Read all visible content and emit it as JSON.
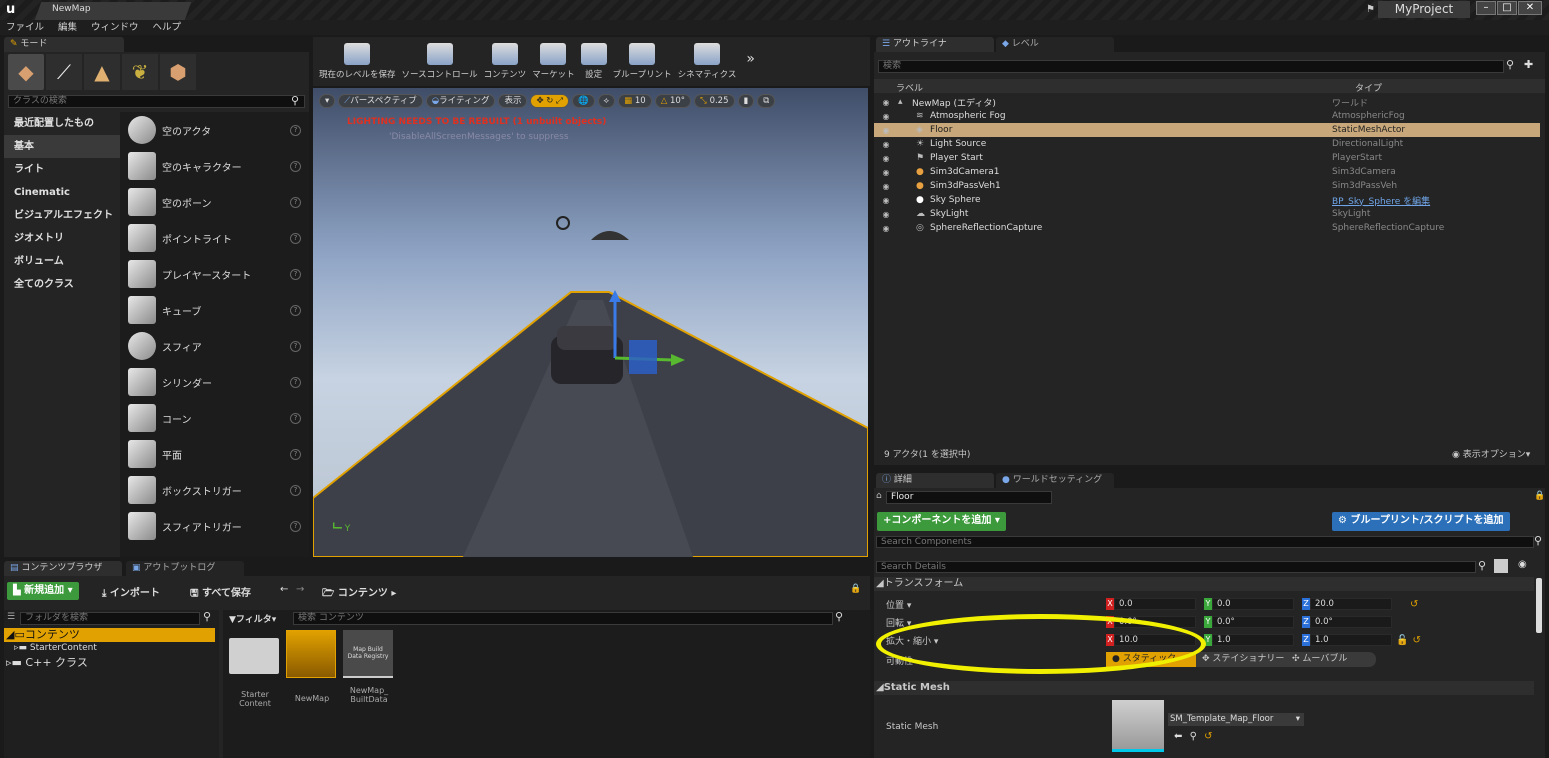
{
  "window": {
    "tab_title": "NewMap",
    "project": "MyProject"
  },
  "menu": [
    "ファイル",
    "編集",
    "ウィンドウ",
    "ヘルプ"
  ],
  "modes": {
    "tab": "モード",
    "search_placeholder": "クラスの検索",
    "categories": [
      "最近配置したもの",
      "基本",
      "ライト",
      "Cinematic",
      "ビジュアルエフェクト",
      "ジオメトリ",
      "ボリューム",
      "全てのクラス"
    ],
    "selected_category": "基本",
    "items": [
      "空のアクタ",
      "空のキャラクター",
      "空のポーン",
      "ポイントライト",
      "プレイヤースタート",
      "キューブ",
      "スフィア",
      "シリンダー",
      "コーン",
      "平面",
      "ボックストリガー",
      "スフィアトリガー"
    ]
  },
  "toolbar": {
    "buttons": [
      "現在のレベルを保存",
      "ソースコントロール",
      "コンテンツ",
      "マーケット",
      "設定",
      "ブループリント",
      "シネマティクス"
    ],
    "more": "»"
  },
  "viewport": {
    "perspective": "パースペクティブ",
    "lighting": "ライティング",
    "show": "表示",
    "grid_snap": "10",
    "rot_snap": "10°",
    "scale_snap": "0.25",
    "warning": "LIGHTING NEEDS TO BE REBUILT (1 unbuilt objects)",
    "suppress": "'DisableAllScreenMessages' to suppress"
  },
  "outliner": {
    "tabs": [
      "アウトライナ",
      "レベル"
    ],
    "search_placeholder": "検索",
    "col_label": "ラベル",
    "col_type": "タイプ",
    "rows": [
      {
        "label": "NewMap (エディタ)",
        "type": "ワールド",
        "icon": "world-icon"
      },
      {
        "label": "Atmospheric Fog",
        "type": "AtmosphericFog",
        "icon": "fog-icon"
      },
      {
        "label": "Floor",
        "type": "StaticMeshActor",
        "icon": "mesh-icon"
      },
      {
        "label": "Light Source",
        "type": "DirectionalLight",
        "icon": "sun-icon"
      },
      {
        "label": "Player Start",
        "type": "PlayerStart",
        "icon": "flag-icon"
      },
      {
        "label": "Sim3dCamera1",
        "type": "Sim3dCamera",
        "icon": "actor-icon"
      },
      {
        "label": "Sim3dPassVeh1",
        "type": "Sim3dPassVeh",
        "icon": "actor-icon"
      },
      {
        "label": "Sky Sphere",
        "type": "BP_Sky_Sphere を編集",
        "icon": "sphere-icon"
      },
      {
        "label": "SkyLight",
        "type": "SkyLight",
        "icon": "skylight-icon"
      },
      {
        "label": "SphereReflectionCapture",
        "type": "SphereReflectionCapture",
        "icon": "reflection-icon"
      }
    ],
    "count": "9 アクタ(1 を選択中)",
    "view_options": "表示オプション"
  },
  "details": {
    "tabs": [
      "詳細",
      "ワールドセッティング"
    ],
    "name": "Floor",
    "add_component": "+コンポーネントを追加",
    "add_script": "ブループリント/スクリプトを追加",
    "search_components": "Search Components",
    "search_details": "Search Details",
    "transform": "トランスフォーム",
    "location_label": "位置",
    "rotation_label": "回転",
    "scale_label": "拡大・縮小",
    "mobility_label": "可動性",
    "location": [
      "0.0",
      "0.0",
      "20.0"
    ],
    "rotation": [
      "0.0°",
      "0.0°",
      "0.0°"
    ],
    "scale": [
      "10.0",
      "1.0",
      "1.0"
    ],
    "mobility": [
      "スタティック",
      "ステイショナリー",
      "ムーバブル"
    ],
    "static_mesh_section": "Static Mesh",
    "static_mesh_label": "Static Mesh",
    "static_mesh_value": "SM_Template_Map_Floor"
  },
  "content": {
    "tabs": [
      "コンテンツブラウザ",
      "アウトプットログ"
    ],
    "add_new": "新規追加",
    "import": "インポート",
    "save_all": "すべて保存",
    "path": "コンテンツ",
    "folder_search": "フォルダを検索",
    "filter": "フィルタ",
    "content_search": "検索 コンテンツ",
    "tree": [
      "コンテンツ",
      "StarterContent",
      "C++ クラス"
    ],
    "assets": [
      {
        "name": "Starter\nContent",
        "kind": "folder"
      },
      {
        "name": "NewMap",
        "kind": "map"
      },
      {
        "name": "NewMap_\nBuiltData",
        "kind": "data",
        "thumb": "Map Build\nData Registry"
      }
    ]
  },
  "colors": {
    "accent": "#e1a100",
    "selected_row": "#c8a87a",
    "green_button": "#3c9a3c",
    "blue_button": "#2b70b8",
    "highlight_ellipse": "#f0f000"
  }
}
